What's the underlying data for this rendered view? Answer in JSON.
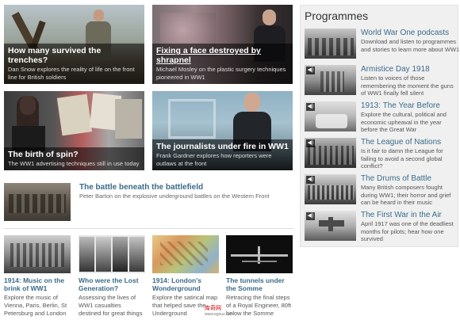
{
  "features": [
    {
      "title": "How many survived the trenches?",
      "desc": "Dan Snow explores the reality of life on the front line for British soldiers"
    },
    {
      "title": "Fixing a face destroyed by shrapnel",
      "desc": "Michael Mosley on the plastic surgery techniques pioneered in WW1"
    },
    {
      "title": "The birth of spin?",
      "desc": "The WW1 advertising techniques still in use today"
    },
    {
      "title": "The journalists under fire in WW1",
      "desc": "Frank Gardner explores how reporters were outlaws at the front"
    }
  ],
  "middle": {
    "title": "The battle beneath the battlefield",
    "desc": "Peter Barton on the explosive underground battles on the Western Front"
  },
  "bottom": [
    {
      "title": "1914: Music on the brink of WW1",
      "desc": "Explore the music of Vienna, Paris, Berlin, St Petersburg and London"
    },
    {
      "title": "Who were the Lost Generation?",
      "desc": "Assessing the lives of WW1 casualties destined for great things"
    },
    {
      "title": "1914: London's Wonderground",
      "desc": "Explore the satirical map that helped save the Underground"
    },
    {
      "title": "The tunnels under the Somme",
      "desc": "Retracing the final steps of a Royal Engineer, 80ft below the Somme"
    }
  ],
  "sidebar": {
    "title": "Programmes",
    "items": [
      {
        "title": "World War One podcasts",
        "desc": "Download and listen to programmes and stories to learn more about WW1"
      },
      {
        "title": "Armistice Day 1918",
        "desc": "Listen to voices of those remembering the moment the guns of WW1 finally fell silent"
      },
      {
        "title": "1913: The Year Before",
        "desc": "Explore the cultural, political and economic upheaval in the year before the Great War"
      },
      {
        "title": "The League of Nations",
        "desc": "Is it fair to damn the League for failing to avoid a second global conflict?"
      },
      {
        "title": "The Drums of Battle",
        "desc": "Many British composers fought during WW1; their horror and grief can be heard in their music"
      },
      {
        "title": "The First War in the Air",
        "desc": "April 1917 was one of the deadliest months for pilots; hear how one survived"
      }
    ]
  },
  "watermark": {
    "line1": "库奇网",
    "line2": "www.egouz.com"
  },
  "icons": {
    "speaker": "speaker-icon"
  }
}
